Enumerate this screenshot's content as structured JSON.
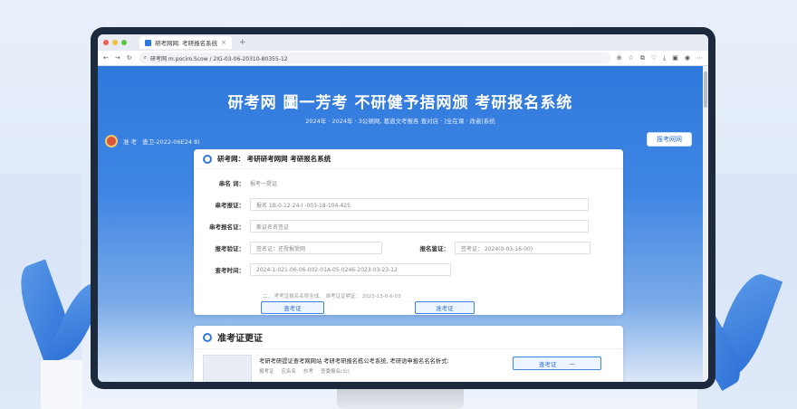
{
  "browser": {
    "tab_title": "研考网网. 考研报名系统",
    "url": "研考网 m.pociro.Scow / 2IG-03-06-20310-80355-12",
    "new_tab": "+"
  },
  "hero": {
    "title": "研考网 圖一芳考 不研健予捂网颁 考研报名系统",
    "subtitle": "2024年 · 2024年 · 3公顿网, 葛道文考报各 查对店 · ]全在课 · 改者|系统",
    "crumb_home": "准 考",
    "crumb_path": "查卫-2022-06E24 8)",
    "register_button": "报考网网"
  },
  "form_card": {
    "header": "研考网： 考研研考网网 考研报名系统",
    "rows": [
      {
        "label": "串名  词：",
        "value": "报考一提证"
      },
      {
        "label": "串考报证：",
        "value": "报名 1B-0-12-24-I -003-18-104-425"
      },
      {
        "label": "串考报名证：",
        "value": "斯证名名签证"
      },
      {
        "label": "报考验证：",
        "value": "签名证：还授报受网"
      },
      {
        "label": "报名鉴证：",
        "value": "签考证：     2024(0-03-16-00)"
      },
      {
        "label": "查考时间：",
        "value": "2024-1-021-06-06-002-01A-05-0246-2023-03-23-12"
      }
    ],
    "hint": "二、 考考证报名名称全成、 准考证证明证：  2023-13-0-6-03",
    "button_left": "查考证",
    "button_right": "准考证"
  },
  "admit_card": {
    "header": "准考证更证",
    "line1": "考研考研提证查考网网站  考研考研报名栋公考系统, 考研语申报名名名析式:",
    "sub": [
      "报考证",
      "应名名",
      "抄考",
      "查委报名(公)"
    ],
    "button": "查考证",
    "button_extra": "一"
  },
  "colors": {
    "accent": "#2f79dd",
    "monitor": "#1d2a3e"
  }
}
